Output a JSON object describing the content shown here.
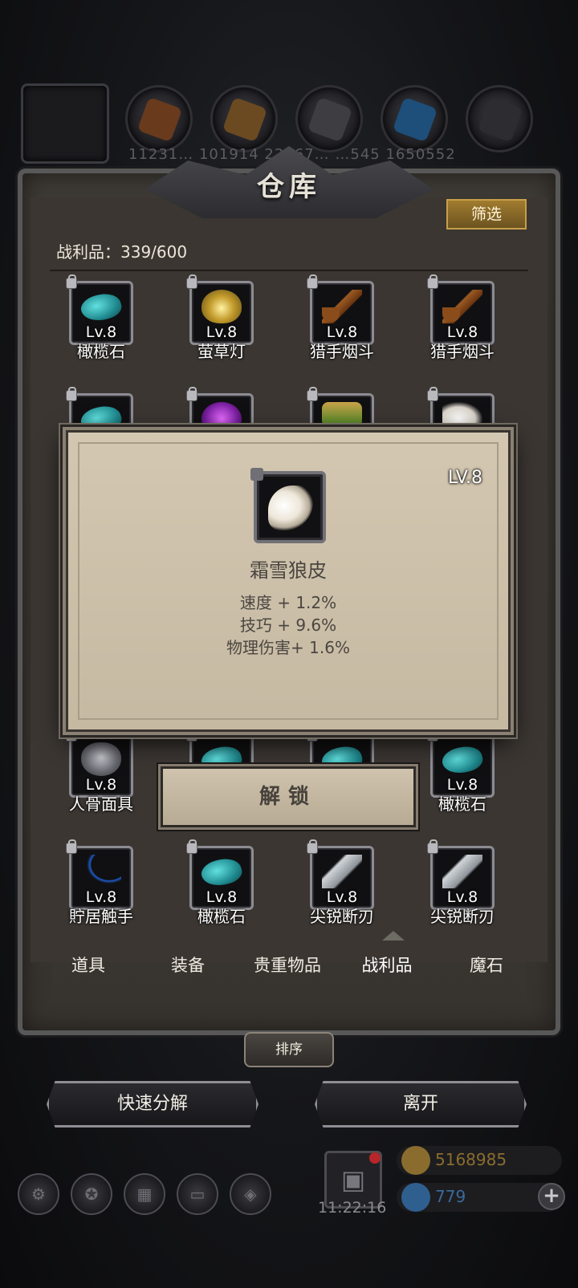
{
  "top_resources": {
    "numbers_text": "11231…    101914  22867…    …545      1650552"
  },
  "panel": {
    "title": "仓库",
    "filter_label": "筛选",
    "count_label": "战利品：339/600"
  },
  "grid": {
    "items": [
      {
        "name": "橄榄石",
        "level": "Lv.8",
        "icon": "olivine-icon"
      },
      {
        "name": "萤草灯",
        "level": "Lv.8",
        "icon": "lantern-icon"
      },
      {
        "name": "猎手烟斗",
        "level": "Lv.8",
        "icon": "pipe-icon"
      },
      {
        "name": "猎手烟斗",
        "level": "Lv.8",
        "icon": "pipe-icon"
      },
      {
        "name": "",
        "level": "",
        "icon": "olivine-icon"
      },
      {
        "name": "",
        "level": "",
        "icon": "purple-gem-icon"
      },
      {
        "name": "",
        "level": "",
        "icon": "potion-icon"
      },
      {
        "name": "",
        "level": "",
        "icon": "fur-icon"
      },
      {
        "name": "人骨面具",
        "level": "Lv.8",
        "icon": "mask-icon"
      },
      {
        "name": "",
        "level": "",
        "icon": "item-icon"
      },
      {
        "name": "",
        "level": "",
        "icon": "item-icon"
      },
      {
        "name": "橄榄石",
        "level": "Lv.8",
        "icon": "olivine-icon"
      },
      {
        "name": "貯居触手",
        "level": "Lv.8",
        "icon": "claw-icon"
      },
      {
        "name": "橄榄石",
        "level": "Lv.8",
        "icon": "olivine-icon"
      },
      {
        "name": "尖锐断刃",
        "level": "Lv.8",
        "icon": "blade-icon"
      },
      {
        "name": "尖锐断刃",
        "level": "Lv.8",
        "icon": "blade-icon"
      }
    ]
  },
  "tabs": [
    {
      "label": "道具",
      "active": false
    },
    {
      "label": "装备",
      "active": false
    },
    {
      "label": "贵重物品",
      "active": false
    },
    {
      "label": "战利品",
      "active": true
    },
    {
      "label": "魔石",
      "active": false
    }
  ],
  "sort_label": "排序",
  "buttons": {
    "quick_decompose": "快速分解",
    "leave": "离开"
  },
  "hud": {
    "clock": "11:22:16",
    "gold": "5168985",
    "gems": "779",
    "gold_color": "#8a6d2e",
    "gem_color": "#2f5f8f"
  },
  "popup": {
    "level": "LV.8",
    "item_name": "霜雪狼皮",
    "stats": [
      "速度 + 1.2%",
      "技巧 + 9.6%",
      "物理伤害+ 1.6%"
    ],
    "unlock_label": "解锁"
  }
}
